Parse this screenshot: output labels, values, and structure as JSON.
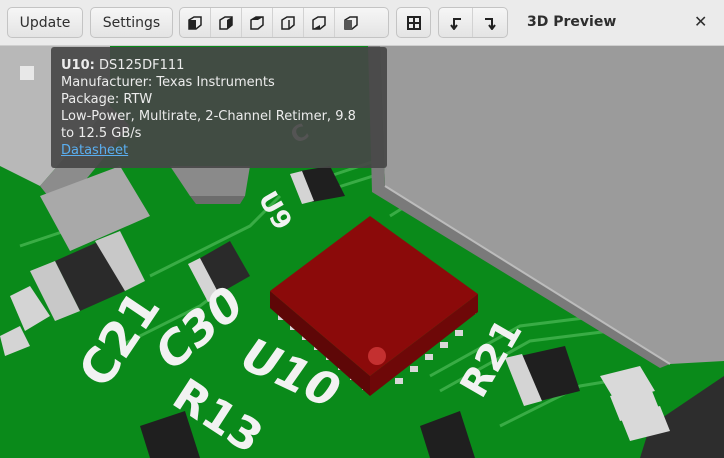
{
  "toolbar": {
    "update_label": "Update",
    "settings_label": "Settings",
    "view_buttons": [
      "view-front-icon",
      "view-back-icon",
      "view-left-icon",
      "view-right-icon",
      "view-top-icon",
      "view-bottom-icon"
    ],
    "fit_icon": "zoom-fit-icon",
    "rotate_left_icon": "rotate-left-icon",
    "rotate_right_icon": "rotate-right-icon",
    "title": "3D Preview",
    "close_glyph": "✕"
  },
  "board": {
    "labels": {
      "c21": "C21",
      "c30": "C30",
      "u10": "U10",
      "r13": "R13",
      "r21": "R21",
      "u9": "U9",
      "c_top": "C"
    },
    "colors": {
      "pcb": "#0a8a1a",
      "copper_trace": "#3fb04a",
      "ic_body": "#8b0a0a",
      "pin1_dot": "#c43030",
      "silkscreen": "#f2f2f2",
      "housing": "#9a9a9a"
    }
  },
  "tooltip": {
    "ref": "U10:",
    "part": "DS125DF111",
    "manufacturer": "Manufacturer: Texas Instruments",
    "package": "Package: RTW",
    "description": "Low-Power, Multirate, 2-Channel Retimer, 9.8 to 12.5 GB/s",
    "datasheet_label": "Datasheet"
  }
}
